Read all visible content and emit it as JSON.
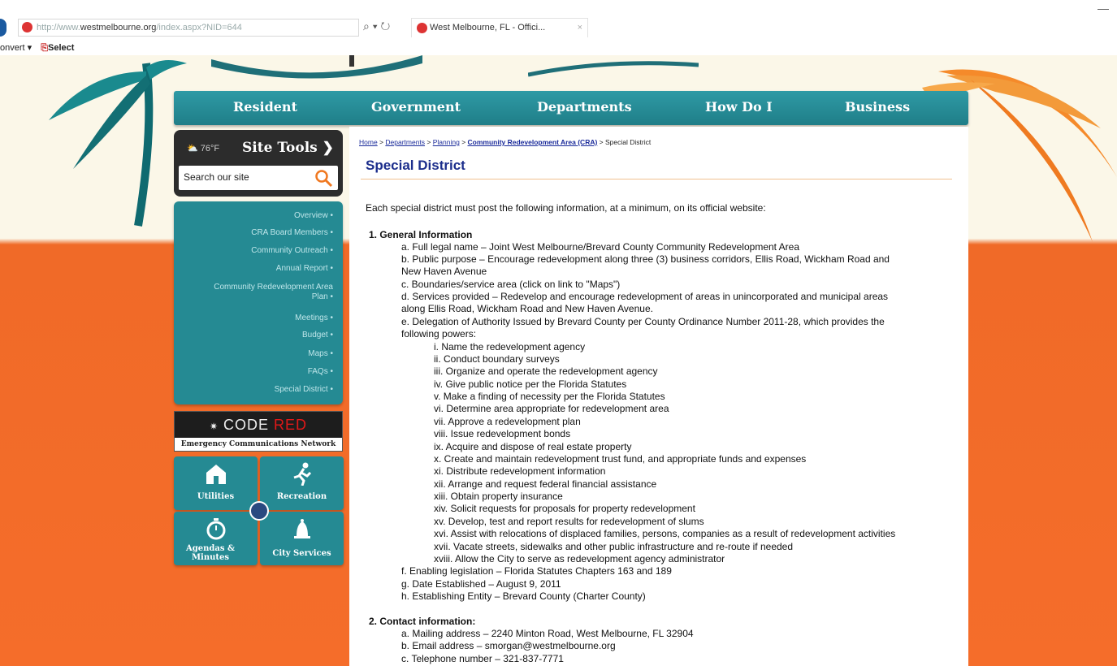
{
  "browser": {
    "url_prefix": "http://www.",
    "url_domain": "westmelbourne.org",
    "url_path": "/index.aspx?NID=644",
    "tab_title": "West Melbourne, FL - Offici...",
    "toolbar_convert": "onvert",
    "toolbar_select": "Select",
    "search_glyph": "⌕ ▾ ↻"
  },
  "nav": [
    "Resident",
    "Government",
    "Departments",
    "How Do I",
    "Business"
  ],
  "site_tools": {
    "weather": "76°F",
    "title": "Site Tools",
    "search_placeholder": "Search our site"
  },
  "subnav": [
    "Overview",
    "CRA Board Members",
    "Community Outreach",
    "Annual Report",
    "Community Redevelopment Area Plan",
    "Meetings",
    "Budget",
    "Maps",
    "FAQs",
    "Special District"
  ],
  "code_red": {
    "code": "CODE",
    "red": "RED",
    "subtitle": "Emergency Communications Network"
  },
  "tiles": [
    "Utilities",
    "Recreation",
    "Agendas & Minutes",
    "City Services"
  ],
  "breadcrumb": {
    "home": "Home",
    "departments": "Departments",
    "planning": "Planning",
    "cra": "Community Redevelopment Area (CRA)",
    "current": "Special District",
    "sep": " > "
  },
  "page_title": "Special District",
  "intro": "Each special district must post the following information, at a minimum, on its official website:",
  "section1_title": "1. General Information",
  "section1": [
    "a. Full legal name – Joint West Melbourne/Brevard County Community Redevelopment Area",
    "b. Public purpose – Encourage redevelopment along three (3) business corridors, Ellis Road, Wickham Road and",
    "New Haven Avenue",
    "c. Boundaries/service area (click on link to \"Maps\")",
    "d. Services provided – Redevelop and encourage redevelopment of areas in unincorporated and municipal areas",
    "along Ellis Road, Wickham Road and New Haven Avenue.",
    "e. Delegation of Authority Issued by Brevard County per County Ordinance Number 2011-28, which provides the",
    "following powers:"
  ],
  "powers": [
    "i. Name the redevelopment agency",
    "ii. Conduct boundary surveys",
    "iii. Organize and operate the redevelopment agency",
    "iv. Give public notice per the Florida Statutes",
    "v. Make a finding of necessity per the Florida Statutes",
    "vi. Determine area appropriate for redevelopment area",
    "vii. Approve a redevelopment plan",
    "viii. Issue redevelopment bonds",
    "ix. Acquire and dispose of real estate property",
    "x. Create and maintain redevelopment trust fund, and appropriate funds and expenses",
    "xi. Distribute redevelopment information",
    "xii. Arrange and request federal financial assistance",
    "xiii. Obtain property insurance",
    "xiv. Solicit requests for proposals for property redevelopment",
    "xv. Develop, test and report results for redevelopment of slums",
    "xvi. Assist with relocations of displaced families, persons, companies as a result of redevelopment activities",
    "xvii. Vacate streets, sidewalks and other public infrastructure and re-route if needed",
    "xviii. Allow the City to serve as redevelopment agency administrator"
  ],
  "section1_tail": [
    "f. Enabling legislation – Florida Statutes Chapters 163 and 189",
    "g. Date Established – August 9, 2011",
    "h. Establishing Entity – Brevard County (Charter County)"
  ],
  "section2_title": "2. Contact information:",
  "section2": [
    "a. Mailing address – 2240 Minton Road, West Melbourne, FL 32904",
    "b. Email address – smorgan@westmelbourne.org",
    "c. Telephone number – 321-837-7771"
  ],
  "colors": {
    "teal": "#258a93",
    "orange": "#f06a28",
    "title_blue": "#1c2e8c"
  }
}
